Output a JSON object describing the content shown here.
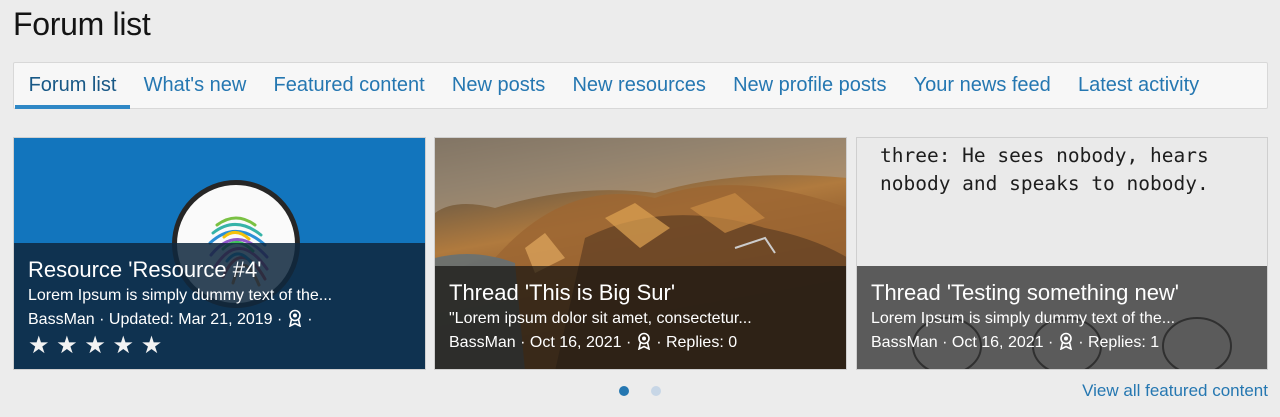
{
  "page": {
    "title": "Forum list"
  },
  "tabs": [
    {
      "label": "Forum list",
      "active": true
    },
    {
      "label": "What's new"
    },
    {
      "label": "Featured content"
    },
    {
      "label": "New posts"
    },
    {
      "label": "New resources"
    },
    {
      "label": "New profile posts"
    },
    {
      "label": "Your news feed"
    },
    {
      "label": "Latest activity"
    }
  ],
  "featured": [
    {
      "title": "Resource 'Resource #4'",
      "snippet": "Lorem Ipsum is simply dummy text of the...",
      "meta": "BassMan · Updated: Mar 21, 2019 · ",
      "meta_after_icon": " ·",
      "rating": 5,
      "stars": "★ ★ ★ ★ ★",
      "image": "fingerprint-logo"
    },
    {
      "title": "Thread 'This is Big Sur'",
      "snippet": "\"Lorem ipsum dolor sit amet, consectetur...",
      "meta": "BassMan · Oct 16, 2021 · ",
      "meta_after_icon": " · Replies: 0",
      "image": "big-sur-landscape"
    },
    {
      "title": "Thread 'Testing something new'",
      "snippet": "Lorem Ipsum is simply dummy text of the...",
      "meta": "BassMan · Oct 16, 2021 · ",
      "meta_after_icon": " · Replies: 1",
      "image_text_line1": "three: He sees nobody, hears",
      "image_text_line2": "nobody and speaks to nobody."
    }
  ],
  "carousel": {
    "pages": 2,
    "current": 1
  },
  "view_all": "View all featured content",
  "colors": {
    "link": "#2577b1",
    "accent": "#2f88c6",
    "card_blue": "#1275bd"
  }
}
